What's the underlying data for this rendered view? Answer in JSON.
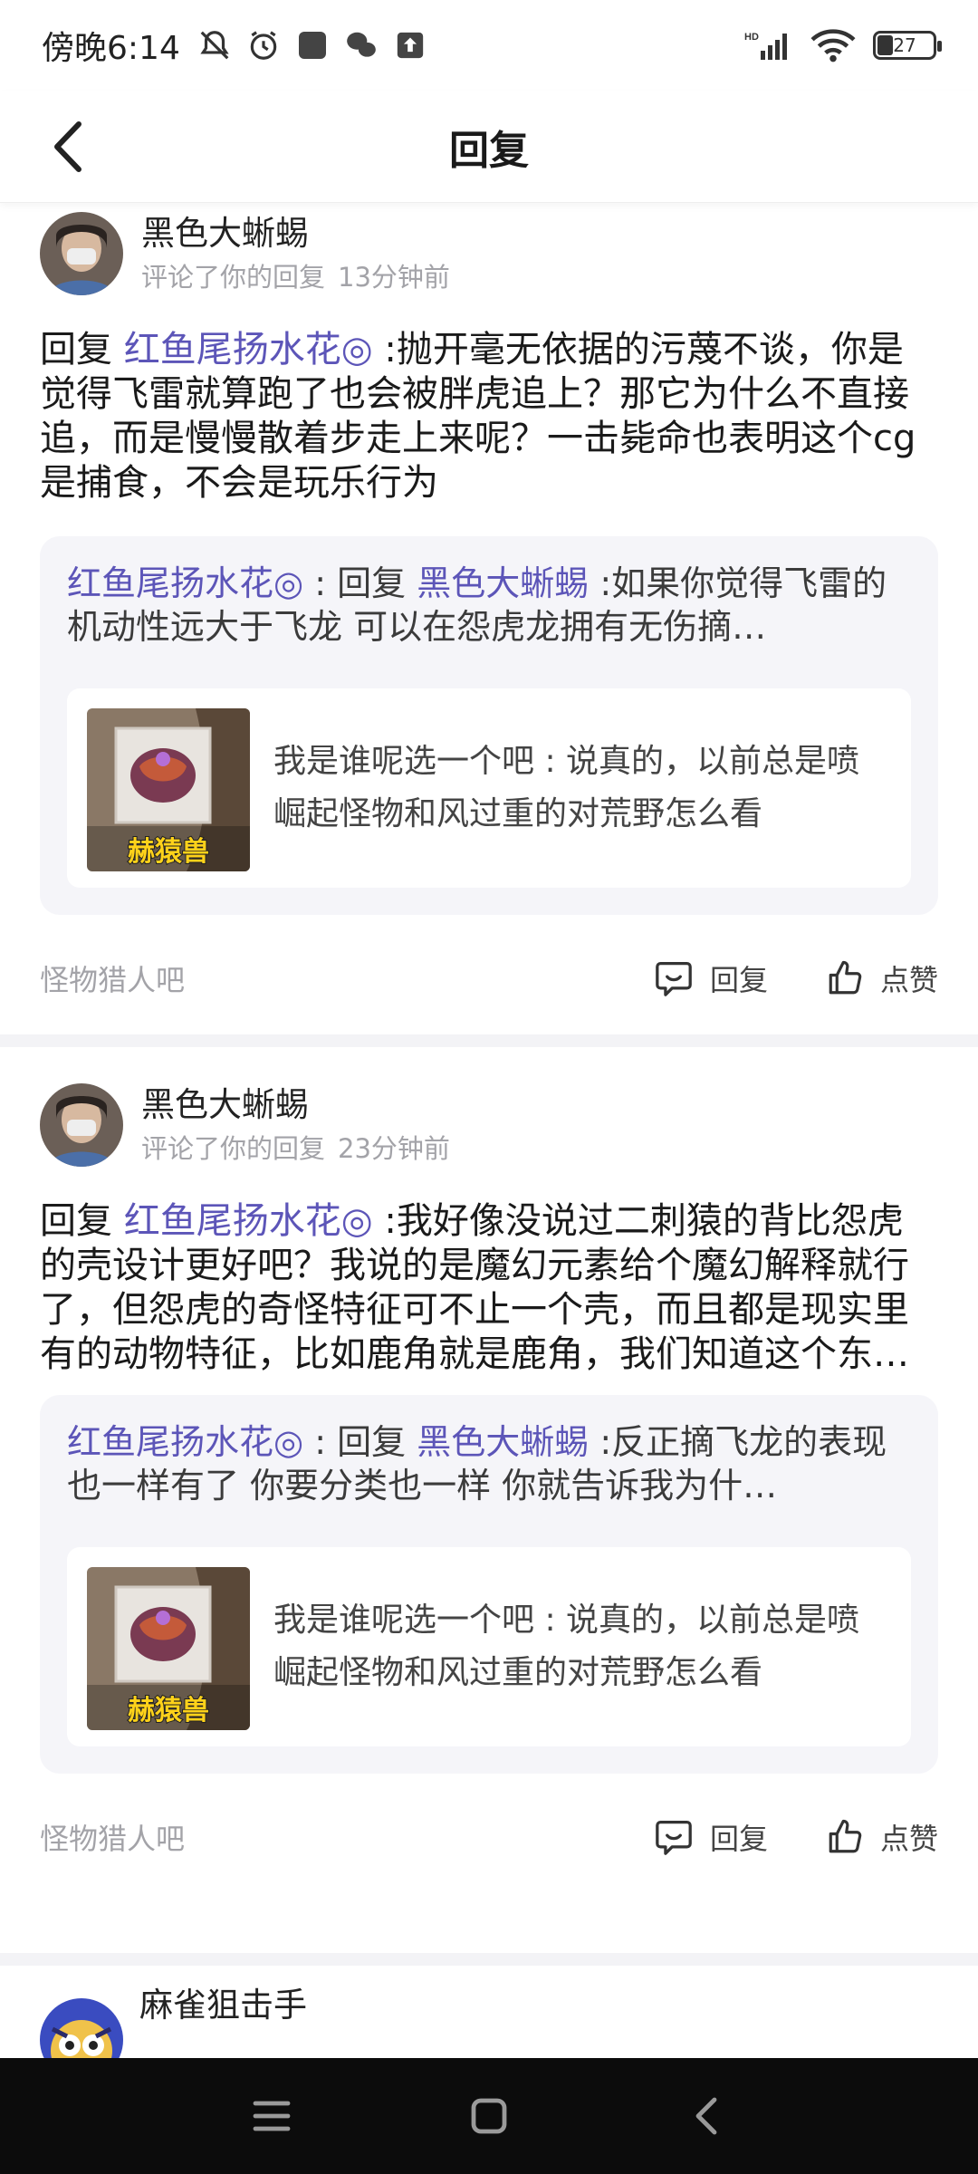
{
  "status_bar": {
    "time": "傍晚6:14",
    "battery": "27",
    "network_label": "HD"
  },
  "nav": {
    "title": "回复"
  },
  "cards": [
    {
      "user_name": "黑色大蜥蜴",
      "action_text": "评论了你的回复",
      "time_ago": "13分钟前",
      "reply_prefix": "回复",
      "reply_target": "红鱼尾扬水花◎",
      "reply_body": " :抛开毫无依据的污蔑不谈，你是觉得飞雷就算跑了也会被胖虎追上？那它为什么不直接追，而是慢慢散着步走上来呢？一击毙命也表明这个cg是捕食，不会是玩乐行为",
      "quote_author": "红鱼尾扬水花◎",
      "quote_sep": " : 回复 ",
      "quote_target": "黑色大蜥蜴",
      "quote_body": " :如果你觉得飞雷的机动性远大于飞龙 可以在怨虎龙拥有无伤摘…",
      "post_author": "我是谁呢选一个吧",
      "post_sep": " : ",
      "post_body": "说真的，以前总是喷崛起怪物和风过重的对荒野怎么看",
      "thumb_label": "赫猿兽",
      "forum": "怪物猎人吧",
      "reply_label": "回复",
      "like_label": "点赞"
    },
    {
      "user_name": "黑色大蜥蜴",
      "action_text": "评论了你的回复",
      "time_ago": "23分钟前",
      "reply_prefix": "回复",
      "reply_target": "红鱼尾扬水花◎",
      "reply_body": " :我好像没说过二刺猿的背比怨虎的壳设计更好吧？我说的是魔幻元素给个魔幻解释就行了，但怨虎的奇怪特征可不止一个壳，而且都是现实里有的动物特征，比如鹿角就是鹿角，我们知道这个东西能怎么用，他们也没给什么用角控火之类…",
      "quote_author": "红鱼尾扬水花◎",
      "quote_sep": " : 回复 ",
      "quote_target": "黑色大蜥蜴",
      "quote_body": " :反正摘飞龙的表现也一样有了 你要分类也一样 你就告诉我为什…",
      "post_author": "我是谁呢选一个吧",
      "post_sep": " : ",
      "post_body": "说真的，以前总是喷崛起怪物和风过重的对荒野怎么看",
      "thumb_label": "赫猿兽",
      "forum": "怪物猎人吧",
      "reply_label": "回复",
      "like_label": "点赞"
    },
    {
      "user_name": "麻雀狙击手"
    }
  ],
  "colors": {
    "link": "#5c55b8",
    "muted": "#a3a3a8",
    "quote_bg": "#f5f5f9",
    "separator": "#f3f3f6"
  }
}
